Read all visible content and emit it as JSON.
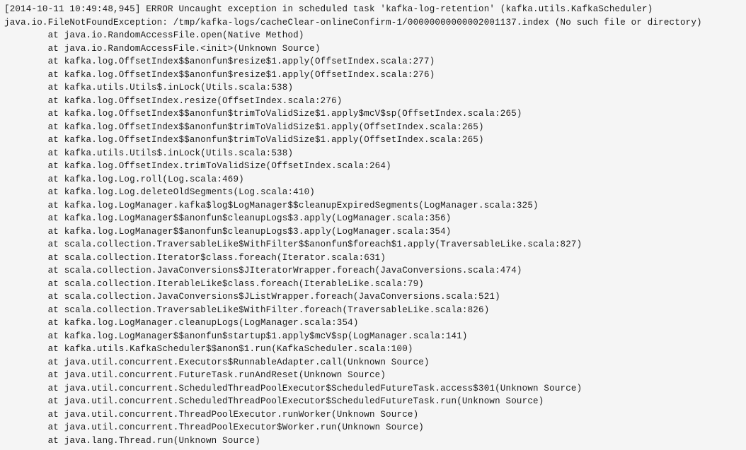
{
  "log": {
    "header": "[2014-10-11 10:49:48,945] ERROR Uncaught exception in scheduled task 'kafka-log-retention' (kafka.utils.KafkaScheduler)",
    "exception": "java.io.FileNotFoundException: /tmp/kafka-logs/cacheClear-onlineConfirm-1/00000000000002001137.index (No such file or directory)",
    "frames": [
      "        at java.io.RandomAccessFile.open(Native Method)",
      "        at java.io.RandomAccessFile.<init>(Unknown Source)",
      "        at kafka.log.OffsetIndex$$anonfun$resize$1.apply(OffsetIndex.scala:277)",
      "        at kafka.log.OffsetIndex$$anonfun$resize$1.apply(OffsetIndex.scala:276)",
      "        at kafka.utils.Utils$.inLock(Utils.scala:538)",
      "        at kafka.log.OffsetIndex.resize(OffsetIndex.scala:276)",
      "        at kafka.log.OffsetIndex$$anonfun$trimToValidSize$1.apply$mcV$sp(OffsetIndex.scala:265)",
      "        at kafka.log.OffsetIndex$$anonfun$trimToValidSize$1.apply(OffsetIndex.scala:265)",
      "        at kafka.log.OffsetIndex$$anonfun$trimToValidSize$1.apply(OffsetIndex.scala:265)",
      "        at kafka.utils.Utils$.inLock(Utils.scala:538)",
      "        at kafka.log.OffsetIndex.trimToValidSize(OffsetIndex.scala:264)",
      "        at kafka.log.Log.roll(Log.scala:469)",
      "        at kafka.log.Log.deleteOldSegments(Log.scala:410)",
      "        at kafka.log.LogManager.kafka$log$LogManager$$cleanupExpiredSegments(LogManager.scala:325)",
      "        at kafka.log.LogManager$$anonfun$cleanupLogs$3.apply(LogManager.scala:356)",
      "        at kafka.log.LogManager$$anonfun$cleanupLogs$3.apply(LogManager.scala:354)",
      "        at scala.collection.TraversableLike$WithFilter$$anonfun$foreach$1.apply(TraversableLike.scala:827)",
      "        at scala.collection.Iterator$class.foreach(Iterator.scala:631)",
      "        at scala.collection.JavaConversions$JIteratorWrapper.foreach(JavaConversions.scala:474)",
      "        at scala.collection.IterableLike$class.foreach(IterableLike.scala:79)",
      "        at scala.collection.JavaConversions$JListWrapper.foreach(JavaConversions.scala:521)",
      "        at scala.collection.TraversableLike$WithFilter.foreach(TraversableLike.scala:826)",
      "        at kafka.log.LogManager.cleanupLogs(LogManager.scala:354)",
      "        at kafka.log.LogManager$$anonfun$startup$1.apply$mcV$sp(LogManager.scala:141)",
      "        at kafka.utils.KafkaScheduler$$anon$1.run(KafkaScheduler.scala:100)",
      "        at java.util.concurrent.Executors$RunnableAdapter.call(Unknown Source)",
      "        at java.util.concurrent.FutureTask.runAndReset(Unknown Source)",
      "        at java.util.concurrent.ScheduledThreadPoolExecutor$ScheduledFutureTask.access$301(Unknown Source)",
      "        at java.util.concurrent.ScheduledThreadPoolExecutor$ScheduledFutureTask.run(Unknown Source)",
      "        at java.util.concurrent.ThreadPoolExecutor.runWorker(Unknown Source)",
      "        at java.util.concurrent.ThreadPoolExecutor$Worker.run(Unknown Source)",
      "        at java.lang.Thread.run(Unknown Source)"
    ]
  }
}
